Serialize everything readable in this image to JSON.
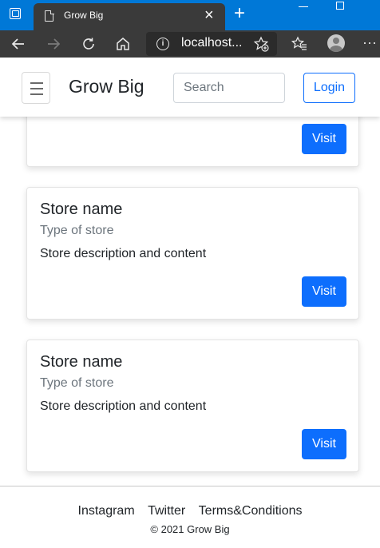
{
  "browser": {
    "tab_title": "Grow Big",
    "tab_close": "×",
    "new_tab": "+",
    "address": "localhost...",
    "info": "i",
    "icons": {
      "back": "back-arrow-icon",
      "forward": "forward-arrow-icon",
      "refresh": "refresh-icon",
      "home": "home-icon",
      "favorite": "add-favorite-icon",
      "favorites": "favorites-icon",
      "profile": "profile-icon",
      "more": "more-icon"
    }
  },
  "navbar": {
    "brand": "Grow Big",
    "search_placeholder": "Search",
    "login_label": "Login"
  },
  "cards": [
    {
      "visit_label": "Visit"
    },
    {
      "name": "Store name",
      "type": "Type of store",
      "description": "Store description and content",
      "visit_label": "Visit"
    },
    {
      "name": "Store name",
      "type": "Type of store",
      "description": "Store description and content",
      "visit_label": "Visit"
    }
  ],
  "footer": {
    "links": [
      "Instagram",
      "Twitter",
      "Terms&Conditions"
    ],
    "copyright": "© 2021 Grow Big"
  },
  "colors": {
    "primary": "#0d6efd",
    "titlebar": "#0078d7",
    "toolbar": "#3a3a3a"
  }
}
